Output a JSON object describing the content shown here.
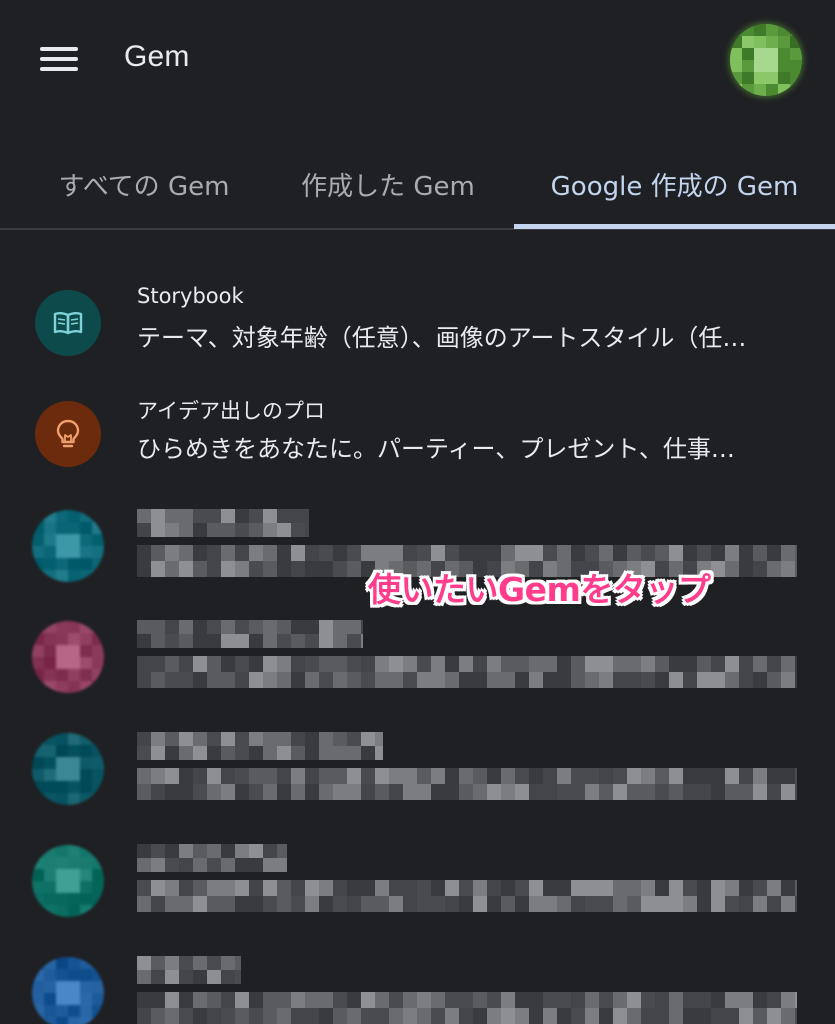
{
  "app": {
    "title": "Gem"
  },
  "tabs": [
    {
      "label": "すべての Gem",
      "selected": false
    },
    {
      "label": "作成した Gem",
      "selected": false
    },
    {
      "label": "Google 作成の Gem",
      "selected": true
    }
  ],
  "gems": [
    {
      "title": "Storybook",
      "description": "テーマ、対象年齢（任意）、画像のアートスタイル（任…",
      "icon": "book-icon",
      "icon_bg": "#0d4a4b",
      "icon_color": "#7fd3d8"
    },
    {
      "title": "アイデア出しのプロ",
      "description": "ひらめきをあなたに。パーティー、プレゼント、仕事…",
      "icon": "lightbulb-icon",
      "icon_bg": "#6b2b0c",
      "icon_color": "#f0a06a"
    }
  ],
  "blurred_gems": [
    {
      "icon_color": "#0f6a7a"
    },
    {
      "icon_color": "#8a3a58"
    },
    {
      "icon_color": "#0f5a68"
    },
    {
      "icon_color": "#127468"
    },
    {
      "icon_color": "#1d5a9a"
    }
  ],
  "annotation": "使いたいGemをタップ",
  "colors": {
    "background": "#1f2023",
    "tab_active": "#c2d4ee",
    "annotation": "#ff3d8c",
    "avatar": "#4e8a32"
  }
}
